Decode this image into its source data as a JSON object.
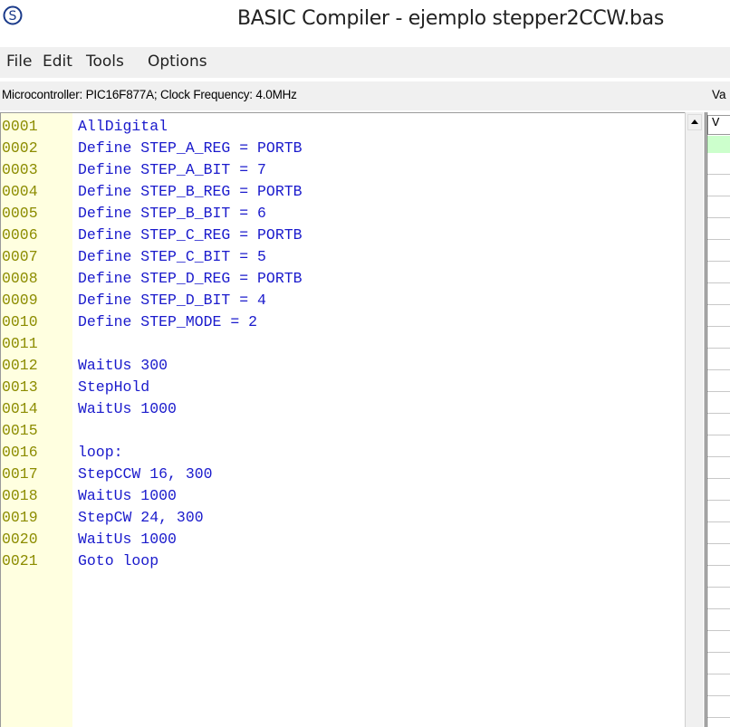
{
  "window": {
    "title": "BASIC Compiler - ejemplo stepper2CCW.bas",
    "icon": "s-circle-app-icon"
  },
  "menu": [
    "File",
    "Edit",
    "Tools",
    "Options"
  ],
  "status": {
    "text": "Microcontroller: PIC16F877A;  Clock Frequency: 4.0MHz",
    "right_panel_header": "Va"
  },
  "editor": {
    "lines": [
      {
        "num": "0001",
        "code": "AllDigital"
      },
      {
        "num": "0002",
        "code": "Define STEP_A_REG = PORTB"
      },
      {
        "num": "0003",
        "code": "Define STEP_A_BIT = 7"
      },
      {
        "num": "0004",
        "code": "Define STEP_B_REG = PORTB"
      },
      {
        "num": "0005",
        "code": "Define STEP_B_BIT = 6"
      },
      {
        "num": "0006",
        "code": "Define STEP_C_REG = PORTB"
      },
      {
        "num": "0007",
        "code": "Define STEP_C_BIT = 5"
      },
      {
        "num": "0008",
        "code": "Define STEP_D_REG = PORTB"
      },
      {
        "num": "0009",
        "code": "Define STEP_D_BIT = 4"
      },
      {
        "num": "0010",
        "code": "Define STEP_MODE = 2"
      },
      {
        "num": "0011",
        "code": ""
      },
      {
        "num": "0012",
        "code": "WaitUs 300"
      },
      {
        "num": "0013",
        "code": "StepHold"
      },
      {
        "num": "0014",
        "code": "WaitUs 1000"
      },
      {
        "num": "0015",
        "code": ""
      },
      {
        "num": "0016",
        "code": "loop:"
      },
      {
        "num": "0017",
        "code": "StepCCW 16, 300"
      },
      {
        "num": "0018",
        "code": "WaitUs 1000"
      },
      {
        "num": "0019",
        "code": "StepCW 24, 300"
      },
      {
        "num": "0020",
        "code": "WaitUs 1000"
      },
      {
        "num": "0021",
        "code": "Goto loop"
      }
    ]
  },
  "side_panel": {
    "header": "V"
  },
  "colors": {
    "gutter": "#ffffe0",
    "line_number": "#8c8c00",
    "code_keyword": "#1a1acc",
    "menu_bg": "#f0f0f0",
    "side_highlight": "#ccffcc"
  }
}
